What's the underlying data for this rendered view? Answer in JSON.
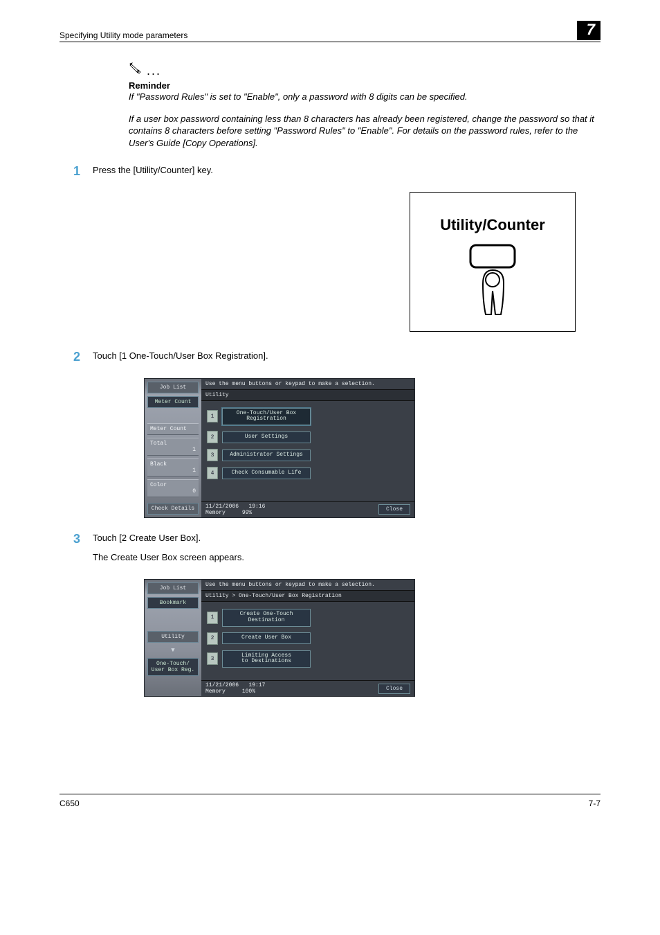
{
  "header": {
    "left": "Specifying Utility mode parameters",
    "right": "7"
  },
  "reminder": {
    "heading": "Reminder",
    "p1": "If \"Password Rules\" is set to \"Enable\", only a password with 8 digits can be specified.",
    "p2": "If a user box password containing less than 8 characters has already been registered, change the password so that it contains 8 characters before setting \"Password Rules\" to \"Enable\". For details on the password rules, refer to the User's Guide [Copy Operations]."
  },
  "steps": {
    "s1": {
      "num": "1",
      "text": "Press the [Utility/Counter] key.",
      "key_label": "Utility/Counter"
    },
    "s2": {
      "num": "2",
      "text": "Touch [1 One-Touch/User Box Registration]."
    },
    "s3": {
      "num": "3",
      "text": "Touch [2 Create User Box].",
      "sub": "The Create User Box screen appears."
    }
  },
  "panel1": {
    "instr": "Use the menu buttons or keypad to make a selection.",
    "crumb": "Utility",
    "left": {
      "job_list": "Job List",
      "meter_btn": "Meter Count",
      "meter_hdr": "Meter Count",
      "total_lbl": "Total",
      "total_val": "1",
      "black_lbl": "Black",
      "black_val": "1",
      "color_lbl": "Color",
      "color_val": "0",
      "check": "Check Details"
    },
    "menu": {
      "n1": "1",
      "b1": "One-Touch/User Box\nRegistration",
      "n2": "2",
      "b2": "User Settings",
      "n3": "3",
      "b3": "Administrator Settings",
      "n4": "4",
      "b4": "Check Consumable Life"
    },
    "status": {
      "date": "11/21/2006",
      "time": "19:16",
      "mem_lbl": "Memory",
      "mem_val": "99%",
      "close": "Close"
    }
  },
  "panel2": {
    "instr": "Use the menu buttons or keypad to make a selection.",
    "crumb": "Utility > One-Touch/User Box Registration",
    "left": {
      "job_list": "Job List",
      "bookmark": "Bookmark",
      "utility": "Utility",
      "box": "One-Touch/\nUser Box Reg."
    },
    "menu": {
      "n1": "1",
      "b1": "Create One-Touch\nDestination",
      "n2": "2",
      "b2": "Create User Box",
      "n3": "3",
      "b3": "Limiting Access\nto Destinations"
    },
    "status": {
      "date": "11/21/2006",
      "time": "19:17",
      "mem_lbl": "Memory",
      "mem_val": "100%",
      "close": "Close"
    }
  },
  "footer": {
    "left": "C650",
    "right": "7-7"
  }
}
